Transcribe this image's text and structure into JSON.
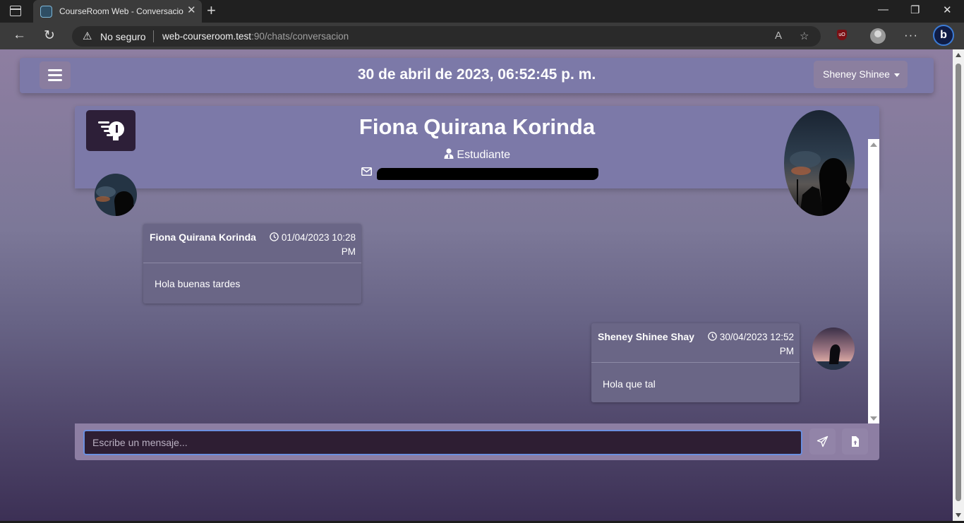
{
  "browser": {
    "tab_title": "CourseRoom Web - Conversacion",
    "security_label": "No seguro",
    "url_host": "web-courseroom.test",
    "url_rest": ":90/chats/conversacion"
  },
  "navbar": {
    "datetime": "30 de abril de 2023, 06:52:45 p. m.",
    "user_button": "Sheney Shinee"
  },
  "contact": {
    "name": "Fiona Quirana Korinda",
    "role": "Estudiante"
  },
  "messages": [
    {
      "sender": "Fiona Quirana Korinda",
      "date": "01/04/2023 10:28",
      "time_suffix": "PM",
      "text": "Hola buenas tardes",
      "side": "left"
    },
    {
      "sender": "Sheney Shinee Shay",
      "date": "30/04/2023 12:52",
      "time_suffix": "PM",
      "text": "Hola que tal",
      "side": "right"
    }
  ],
  "composer": {
    "placeholder": "Escribe un mensaje..."
  },
  "colors": {
    "navbar_bg": "#7c79a8",
    "input_bg": "#2e1e33",
    "input_border": "#6b8fe0",
    "bubble_bg": "#6a6686"
  }
}
